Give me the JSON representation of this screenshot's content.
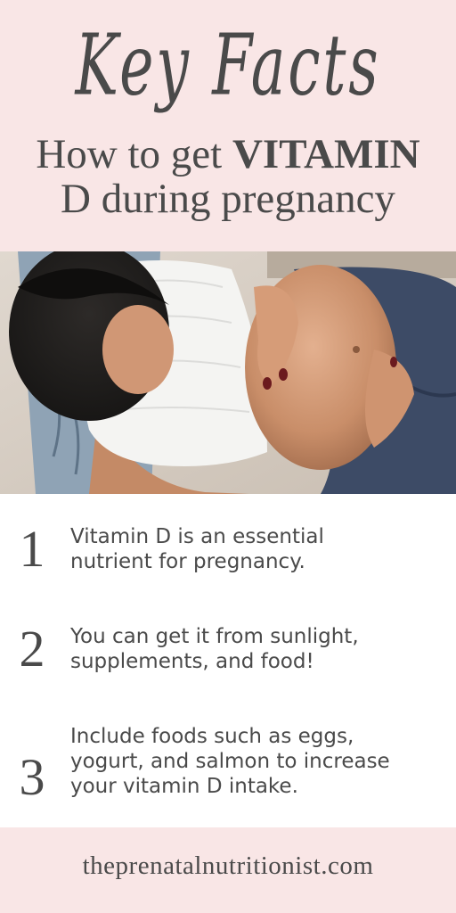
{
  "header": {
    "script_title": "Key Facts",
    "subtitle_line1_normal": "How to get ",
    "subtitle_line1_bold": "VITAMIN",
    "subtitle_line2": "D during pregnancy"
  },
  "facts": [
    {
      "number": "1",
      "line1": "Vitamin D is an essential",
      "line2": "nutrient for pregnancy.",
      "line3": ""
    },
    {
      "number": "2",
      "line1": "You can get it from sunlight,",
      "line2": "supplements, and food!",
      "line3": ""
    },
    {
      "number": "3",
      "line1": "Include foods such as eggs,",
      "line2": "yogurt, and salmon to increase",
      "line3": "your vitamin D intake."
    }
  ],
  "footer": {
    "url": "theprenatalnutritionist.com"
  },
  "colors": {
    "pink_band": "#f9e6e6",
    "text": "#4a4a4a"
  }
}
